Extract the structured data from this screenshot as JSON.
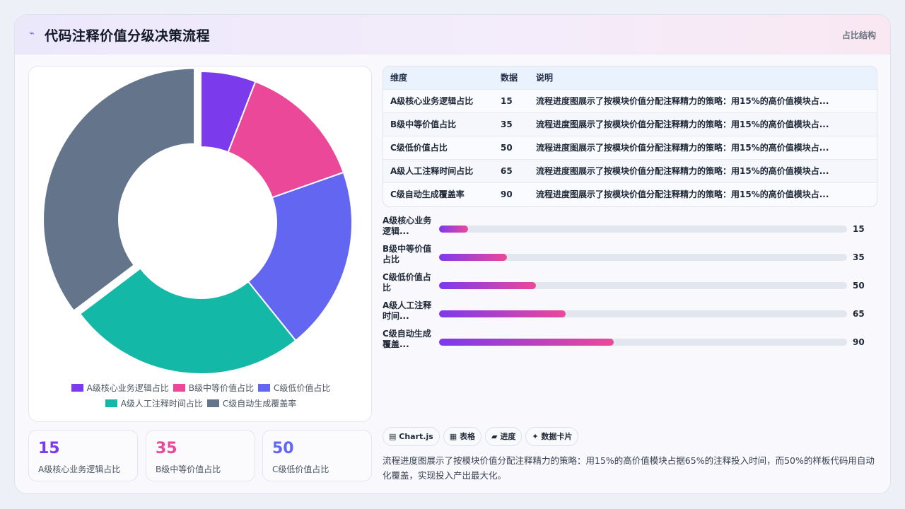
{
  "header": {
    "logo_icon": "sparkle-icon",
    "title": "代码注释价值分级决策流程",
    "tag": "占比结构"
  },
  "colors": {
    "a_core": "#7c3aed",
    "b_mid": "#ec4899",
    "c_low": "#6366f1",
    "a_manual": "#14b8a6",
    "c_auto": "#64748b",
    "gradient_start": "#7c3aed",
    "gradient_end": "#ec4899"
  },
  "chart_data": {
    "type": "pie",
    "variant": "doughnut",
    "categories": [
      "A级核心业务逻辑占比",
      "B级中等价值占比",
      "C级低价值占比",
      "A级人工注释时间占比",
      "C级自动生成覆盖率"
    ],
    "values": [
      15,
      35,
      50,
      65,
      90
    ],
    "colors": [
      "#7c3aed",
      "#ec4899",
      "#6366f1",
      "#14b8a6",
      "#64748b"
    ],
    "legend_position": "bottom",
    "highlighted_slice": "C级自动生成覆盖率"
  },
  "table": {
    "headers": [
      "维度",
      "数据",
      "说明"
    ],
    "rows": [
      [
        "A级核心业务逻辑占比",
        "15",
        "流程进度图展示了按模块价值分配注释精力的策略：用15%的高价值模块占..."
      ],
      [
        "B级中等价值占比",
        "35",
        "流程进度图展示了按模块价值分配注释精力的策略：用15%的高价值模块占..."
      ],
      [
        "C级低价值占比",
        "50",
        "流程进度图展示了按模块价值分配注释精力的策略：用15%的高价值模块占..."
      ],
      [
        "A级人工注释时间占比",
        "65",
        "流程进度图展示了按模块价值分配注释精力的策略：用15%的高价值模块占..."
      ],
      [
        "C级自动生成覆盖率",
        "90",
        "流程进度图展示了按模块价值分配注释精力的策略：用15%的高价值模块占..."
      ]
    ]
  },
  "progress": {
    "max": 210,
    "items": [
      {
        "label": "A级核心业务逻辑...",
        "value": 15
      },
      {
        "label": "B级中等价值占比",
        "value": 35
      },
      {
        "label": "C级低价值占比",
        "value": 50
      },
      {
        "label": "A级人工注释时间...",
        "value": 65
      },
      {
        "label": "C级自动生成覆盖...",
        "value": 90
      }
    ]
  },
  "stats": [
    {
      "value": "15",
      "label": "A级核心业务逻辑占比",
      "color": "#7c3aed"
    },
    {
      "value": "35",
      "label": "B级中等价值占比",
      "color": "#ec4899"
    },
    {
      "value": "50",
      "label": "C级低价值占比",
      "color": "#6366f1"
    }
  ],
  "tags": [
    {
      "icon": "chart-icon",
      "glyph": "▤",
      "label": "Chart.js"
    },
    {
      "icon": "table-icon",
      "glyph": "▦",
      "label": "表格"
    },
    {
      "icon": "progress-icon",
      "glyph": "▰",
      "label": "进度"
    },
    {
      "icon": "card-icon",
      "glyph": "✦",
      "label": "数据卡片"
    }
  ],
  "summary": "流程进度图展示了按模块价值分配注释精力的策略：用15%的高价值模块占据65%的注释投入时间，而50%的样板代码用自动化覆盖，实现投入产出最大化。"
}
